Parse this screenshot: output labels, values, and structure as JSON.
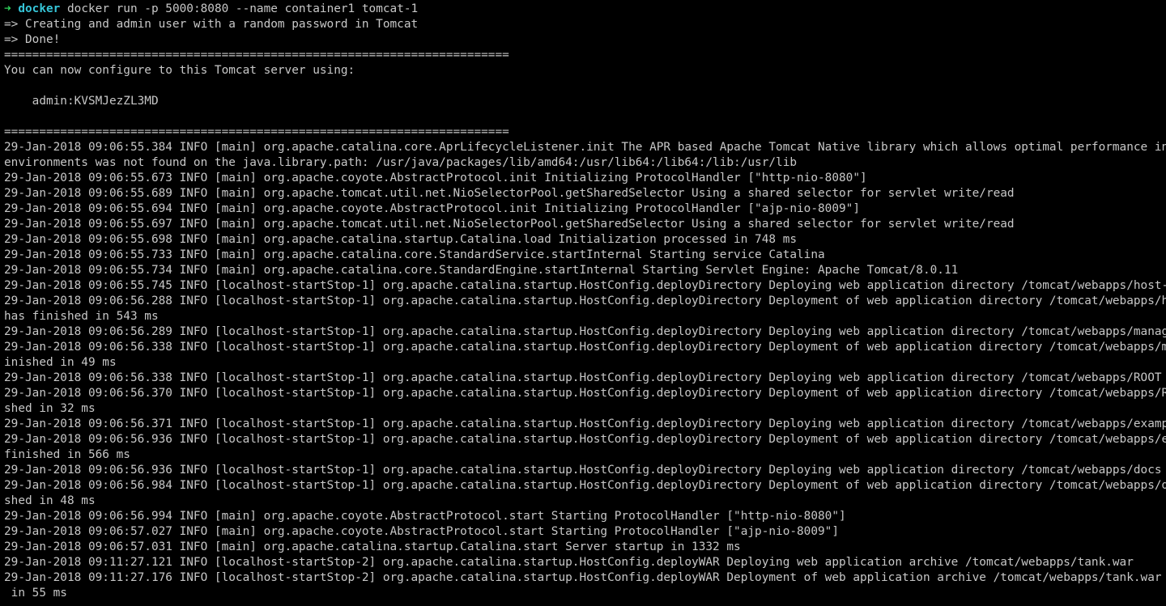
{
  "prompt": {
    "arrow": "➜",
    "dir": "docker",
    "command": "docker run -p 5000:8080 --name container1 tomcat-1"
  },
  "lines": [
    "=> Creating and admin user with a random password in Tomcat",
    "=> Done!",
    "========================================================================",
    "You can now configure to this Tomcat server using:",
    "",
    "    admin:KVSMJezZL3MD",
    "",
    "========================================================================",
    "29-Jan-2018 09:06:55.384 INFO [main] org.apache.catalina.core.AprLifecycleListener.init The APR based Apache Tomcat Native library which allows optimal performance in production",
    "environments was not found on the java.library.path: /usr/java/packages/lib/amd64:/usr/lib64:/lib64:/lib:/usr/lib",
    "29-Jan-2018 09:06:55.673 INFO [main] org.apache.coyote.AbstractProtocol.init Initializing ProtocolHandler [\"http-nio-8080\"]",
    "29-Jan-2018 09:06:55.689 INFO [main] org.apache.tomcat.util.net.NioSelectorPool.getSharedSelector Using a shared selector for servlet write/read",
    "29-Jan-2018 09:06:55.694 INFO [main] org.apache.coyote.AbstractProtocol.init Initializing ProtocolHandler [\"ajp-nio-8009\"]",
    "29-Jan-2018 09:06:55.697 INFO [main] org.apache.tomcat.util.net.NioSelectorPool.getSharedSelector Using a shared selector for servlet write/read",
    "29-Jan-2018 09:06:55.698 INFO [main] org.apache.catalina.startup.Catalina.load Initialization processed in 748 ms",
    "29-Jan-2018 09:06:55.733 INFO [main] org.apache.catalina.core.StandardService.startInternal Starting service Catalina",
    "29-Jan-2018 09:06:55.734 INFO [main] org.apache.catalina.core.StandardEngine.startInternal Starting Servlet Engine: Apache Tomcat/8.0.11",
    "29-Jan-2018 09:06:55.745 INFO [localhost-startStop-1] org.apache.catalina.startup.HostConfig.deployDirectory Deploying web application directory /tomcat/webapps/host-manager",
    "29-Jan-2018 09:06:56.288 INFO [localhost-startStop-1] org.apache.catalina.startup.HostConfig.deployDirectory Deployment of web application directory /tomcat/webapps/host-manager",
    "has finished in 543 ms",
    "29-Jan-2018 09:06:56.289 INFO [localhost-startStop-1] org.apache.catalina.startup.HostConfig.deployDirectory Deploying web application directory /tomcat/webapps/manager",
    "29-Jan-2018 09:06:56.338 INFO [localhost-startStop-1] org.apache.catalina.startup.HostConfig.deployDirectory Deployment of web application directory /tomcat/webapps/manager has f",
    "inished in 49 ms",
    "29-Jan-2018 09:06:56.338 INFO [localhost-startStop-1] org.apache.catalina.startup.HostConfig.deployDirectory Deploying web application directory /tomcat/webapps/ROOT",
    "29-Jan-2018 09:06:56.370 INFO [localhost-startStop-1] org.apache.catalina.startup.HostConfig.deployDirectory Deployment of web application directory /tomcat/webapps/ROOT has fini",
    "shed in 32 ms",
    "29-Jan-2018 09:06:56.371 INFO [localhost-startStop-1] org.apache.catalina.startup.HostConfig.deployDirectory Deploying web application directory /tomcat/webapps/examples",
    "29-Jan-2018 09:06:56.936 INFO [localhost-startStop-1] org.apache.catalina.startup.HostConfig.deployDirectory Deployment of web application directory /tomcat/webapps/examples has",
    "finished in 566 ms",
    "29-Jan-2018 09:06:56.936 INFO [localhost-startStop-1] org.apache.catalina.startup.HostConfig.deployDirectory Deploying web application directory /tomcat/webapps/docs",
    "29-Jan-2018 09:06:56.984 INFO [localhost-startStop-1] org.apache.catalina.startup.HostConfig.deployDirectory Deployment of web application directory /tomcat/webapps/docs has fini",
    "shed in 48 ms",
    "29-Jan-2018 09:06:56.994 INFO [main] org.apache.coyote.AbstractProtocol.start Starting ProtocolHandler [\"http-nio-8080\"]",
    "29-Jan-2018 09:06:57.027 INFO [main] org.apache.coyote.AbstractProtocol.start Starting ProtocolHandler [\"ajp-nio-8009\"]",
    "29-Jan-2018 09:06:57.031 INFO [main] org.apache.catalina.startup.Catalina.start Server startup in 1332 ms",
    "29-Jan-2018 09:11:27.121 INFO [localhost-startStop-2] org.apache.catalina.startup.HostConfig.deployWAR Deploying web application archive /tomcat/webapps/tank.war",
    "29-Jan-2018 09:11:27.176 INFO [localhost-startStop-2] org.apache.catalina.startup.HostConfig.deployWAR Deployment of web application archive /tomcat/webapps/tank.war has finished",
    " in 55 ms"
  ],
  "colors": {
    "background": "#000000",
    "text": "#c7c7c7",
    "prompt_arrow": "#2fd15a",
    "prompt_dir": "#36c5d8"
  }
}
